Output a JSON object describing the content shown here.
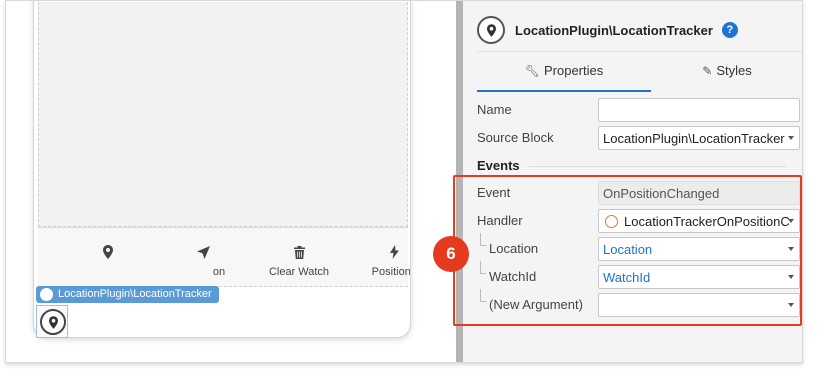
{
  "canvas": {
    "tabs": [
      {
        "icon": "location-pin-icon",
        "label": ""
      },
      {
        "icon": "navigation-arrow-icon",
        "label": "on"
      },
      {
        "icon": "trash-icon",
        "label": "Clear Watch"
      },
      {
        "icon": "lightning-icon",
        "label": "Positions"
      }
    ],
    "selected_badge": "LocationPlugin\\LocationTracker"
  },
  "panel": {
    "title": "LocationPlugin\\LocationTracker",
    "help": "?",
    "tabs": {
      "properties": "Properties",
      "styles": "Styles"
    },
    "name_label": "Name",
    "name_value": "",
    "source_block_label": "Source Block",
    "source_block_value": "LocationPlugin\\LocationTracker",
    "events_title": "Events",
    "event_label": "Event",
    "event_value": "OnPositionChanged",
    "handler_label": "Handler",
    "handler_value": "LocationTrackerOnPositionC",
    "location_label": "Location",
    "location_value": "Location",
    "watchid_label": "WatchId",
    "watchid_value": "WatchId",
    "new_argument_label": "(New Argument)",
    "new_argument_value": ""
  },
  "step": "6",
  "colors": {
    "accent": "#1f74d2",
    "highlight": "#e03d22",
    "badge": "#5b9bd5"
  }
}
